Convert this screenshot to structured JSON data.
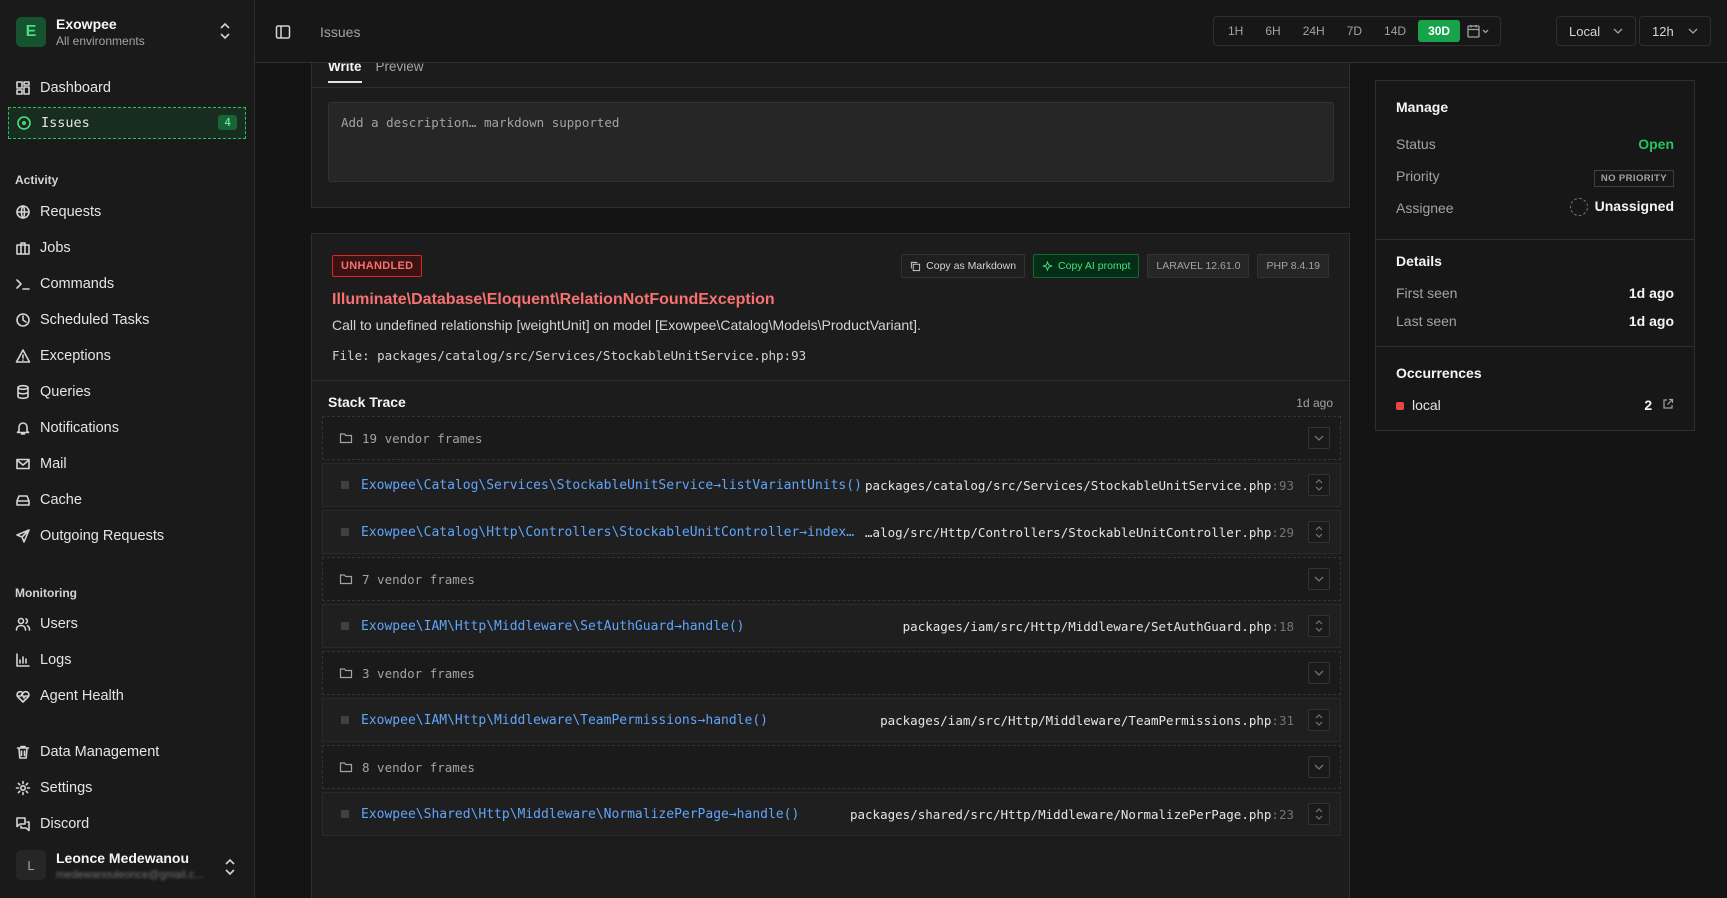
{
  "env": {
    "initial": "E",
    "name": "Exowpee",
    "subtitle": "All environments"
  },
  "nav": {
    "dashboard": "Dashboard",
    "issues": "Issues",
    "issues_count": "4",
    "activity_heading": "Activity",
    "requests": "Requests",
    "jobs": "Jobs",
    "commands": "Commands",
    "scheduled_tasks": "Scheduled Tasks",
    "exceptions": "Exceptions",
    "queries": "Queries",
    "notifications": "Notifications",
    "mail": "Mail",
    "cache": "Cache",
    "outgoing_requests": "Outgoing Requests",
    "monitoring_heading": "Monitoring",
    "users": "Users",
    "logs": "Logs",
    "agent_health": "Agent Health",
    "data_management": "Data Management",
    "settings": "Settings",
    "discord": "Discord"
  },
  "user": {
    "initial": "L",
    "name": "Leonce Medewanou",
    "email": "medewanouleonce@gmail.c..."
  },
  "topbar": {
    "title": "Issues",
    "ranges": [
      "1H",
      "6H",
      "24H",
      "7D",
      "14D",
      "30D"
    ],
    "active_range": "30D",
    "timezone": "Local",
    "clock": "12h"
  },
  "description": {
    "tab_write": "Write",
    "tab_preview": "Preview",
    "placeholder": "Add a description… markdown supported"
  },
  "exception": {
    "badge": "UNHANDLED",
    "copy_markdown": "Copy as Markdown",
    "copy_ai": "Copy AI prompt",
    "framework_tag": "LARAVEL 12.61.0",
    "php_tag": "PHP 8.4.19",
    "class": "Illuminate\\Database\\Eloquent\\RelationNotFoundException",
    "message": "Call to undefined relationship [weightUnit] on model [Exowpee\\Catalog\\Models\\ProductVariant].",
    "file": "File: packages/catalog/src/Services/StockableUnitService.php:93"
  },
  "stack": {
    "heading": "Stack Trace",
    "time": "1d ago",
    "frames": [
      {
        "vendor": true,
        "text": "19 vendor frames"
      },
      {
        "vendor": false,
        "fn": "Exowpee\\Catalog\\Services\\StockableUnitService→listVariantUnits()",
        "path": "packages/catalog/src/Services/StockableUnitService.php",
        "line": ":93"
      },
      {
        "vendor": false,
        "fn": "Exowpee\\Catalog\\Http\\Controllers\\StockableUnitController→index…",
        "path": "…alog/src/Http/Controllers/StockableUnitController.php",
        "line": ":29"
      },
      {
        "vendor": true,
        "text": "7 vendor frames"
      },
      {
        "vendor": false,
        "fn": "Exowpee\\IAM\\Http\\Middleware\\SetAuthGuard→handle()",
        "path": "packages/iam/src/Http/Middleware/SetAuthGuard.php",
        "line": ":18"
      },
      {
        "vendor": true,
        "text": "3 vendor frames"
      },
      {
        "vendor": false,
        "fn": "Exowpee\\IAM\\Http\\Middleware\\TeamPermissions→handle()",
        "path": "packages/iam/src/Http/Middleware/TeamPermissions.php",
        "line": ":31"
      },
      {
        "vendor": true,
        "text": "8 vendor frames"
      },
      {
        "vendor": false,
        "fn": "Exowpee\\Shared\\Http\\Middleware\\NormalizePerPage→handle()",
        "path": "packages/shared/src/Http/Middleware/NormalizePerPage.php",
        "line": ":23"
      }
    ]
  },
  "manage": {
    "heading": "Manage",
    "status_label": "Status",
    "status_value": "Open",
    "priority_label": "Priority",
    "priority_value": "NO PRIORITY",
    "assignee_label": "Assignee",
    "assignee_value": "Unassigned"
  },
  "details": {
    "heading": "Details",
    "first_seen_label": "First seen",
    "first_seen_value": "1d ago",
    "last_seen_label": "Last seen",
    "last_seen_value": "1d ago"
  },
  "occurrences": {
    "heading": "Occurrences",
    "env": "local",
    "count": "2"
  },
  "colors": {
    "accent": "#16a34a",
    "error": "#f87171",
    "link": "#60a5fa",
    "background": "#141414"
  }
}
